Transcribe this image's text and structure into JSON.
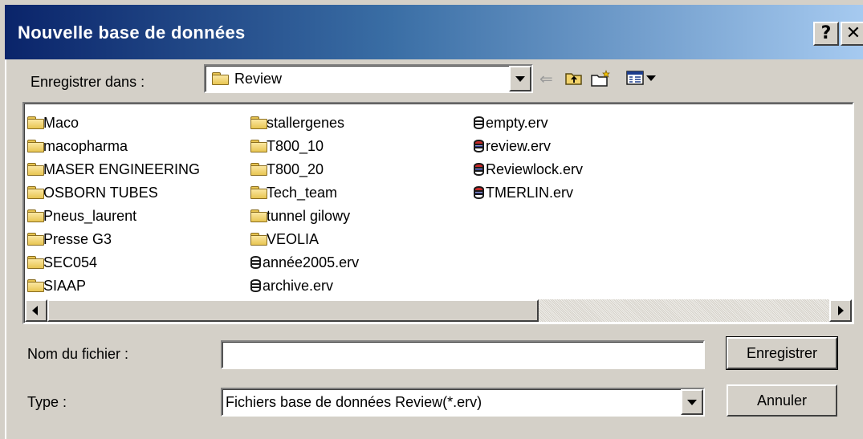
{
  "dialog": {
    "title": "Nouvelle base de données",
    "help_label": "?",
    "close_label": "✕"
  },
  "save_in": {
    "label": "Enregistrer dans :",
    "value": "Review"
  },
  "toolbar": {
    "back_icon": "back-arrow-icon",
    "up_icon": "up-folder-icon",
    "new_folder_icon": "new-folder-icon",
    "views_icon": "views-menu-icon"
  },
  "files": {
    "col1": [
      {
        "name": "Maco",
        "type": "folder"
      },
      {
        "name": "macopharma",
        "type": "folder"
      },
      {
        "name": "MASER ENGINEERING",
        "type": "folder"
      },
      {
        "name": "OSBORN TUBES",
        "type": "folder"
      },
      {
        "name": "Pneus_laurent",
        "type": "folder"
      },
      {
        "name": "Presse G3",
        "type": "folder"
      },
      {
        "name": "SEC054",
        "type": "folder"
      },
      {
        "name": "SIAAP",
        "type": "folder"
      }
    ],
    "col2": [
      {
        "name": "stallergenes",
        "type": "folder"
      },
      {
        "name": "T800_10",
        "type": "folder"
      },
      {
        "name": "T800_20",
        "type": "folder"
      },
      {
        "name": "Tech_team",
        "type": "folder"
      },
      {
        "name": "tunnel gilowy",
        "type": "folder"
      },
      {
        "name": "VEOLIA",
        "type": "folder"
      },
      {
        "name": "année2005.erv",
        "type": "db"
      },
      {
        "name": "archive.erv",
        "type": "db"
      }
    ],
    "col3": [
      {
        "name": "empty.erv",
        "type": "db"
      },
      {
        "name": "review.erv",
        "type": "db-color"
      },
      {
        "name": "Reviewlock.erv",
        "type": "db-color"
      },
      {
        "name": "TMERLIN.erv",
        "type": "db-color"
      }
    ]
  },
  "filename": {
    "label": "Nom du fichier :",
    "value": ""
  },
  "filetype": {
    "label": "Type :",
    "value": "Fichiers base de données Review(*.erv)"
  },
  "buttons": {
    "save": "Enregistrer",
    "cancel": "Annuler"
  },
  "colors": {
    "title_start": "#0a246a",
    "title_end": "#a6caf0",
    "face": "#d4d0c8"
  }
}
